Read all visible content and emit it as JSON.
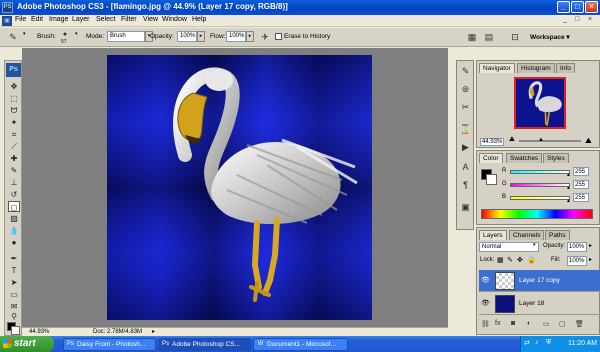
{
  "window": {
    "app_icon": "PS",
    "title": "Adobe Photoshop CS3 - [flamingo.jpg @ 44.9% (Layer 17 copy, RGB/8)]",
    "minimize": "_",
    "maximize": "□",
    "close": "×"
  },
  "menu": {
    "items": [
      "File",
      "Edit",
      "Image",
      "Layer",
      "Select",
      "Filter",
      "View",
      "Window",
      "Help"
    ],
    "doc_minimize": "_",
    "doc_restore": "□",
    "doc_close": "×"
  },
  "options": {
    "brush_label": "Brush:",
    "brush_size": "57",
    "mode_label": "Mode:",
    "mode_value": "Brush",
    "opacity_label": "Opacity:",
    "opacity_value": "100%",
    "flow_label": "Flow:",
    "flow_value": "100%",
    "erase_history_label": "Erase to History",
    "workspace_label": "Workspace ▾"
  },
  "tools": {
    "badge": "Ps",
    "foreground_color": "#000000",
    "background_color": "#ffffff"
  },
  "document": {
    "background_color": "#0a0f7c",
    "zoom": "44.93%",
    "doc_info": "Doc: 2.78M/4.83M"
  },
  "navigator": {
    "tabs": [
      "Navigator",
      "Histogram",
      "Info"
    ],
    "zoom": "44.93%"
  },
  "color_panel": {
    "tabs": [
      "Color",
      "Swatches",
      "Styles"
    ],
    "channels": [
      {
        "label": "R",
        "value": "255",
        "color": "#ff0000"
      },
      {
        "label": "G",
        "value": "255",
        "color": "#00b000"
      },
      {
        "label": "B",
        "value": "255",
        "color": "#0000ff"
      }
    ]
  },
  "layers_panel": {
    "tabs": [
      "Layers",
      "Channels",
      "Paths"
    ],
    "blend_mode": "Normal",
    "opacity_label": "Opacity:",
    "opacity_value": "100%",
    "lock_label": "Lock:",
    "fill_label": "Fill:",
    "fill_value": "100%",
    "layers": [
      {
        "name": "Layer 17 copy",
        "selected": true
      },
      {
        "name": "Layer 18",
        "selected": false
      }
    ]
  },
  "taskbar": {
    "start_label": "start",
    "buttons": [
      {
        "label": "Daisy Front - Photosh...",
        "active": false
      },
      {
        "label": "Adobe Photoshop CS...",
        "active": true
      },
      {
        "label": "Document1 - Microsof...",
        "active": false
      }
    ],
    "clock": "11:20 AM"
  }
}
